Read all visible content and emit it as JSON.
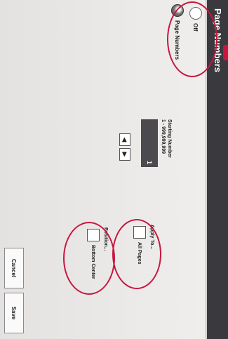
{
  "dialog": {
    "title": "Page Numbers"
  },
  "options": {
    "off_label": "Off",
    "page_numbers_label": "Page Numbers",
    "selected": "Page Numbers"
  },
  "starting_number": {
    "label_line1": "Starting Number",
    "label_line2": "1 - 999,999,999",
    "value": "1"
  },
  "stepper": {
    "prev": "◀",
    "next": "▶"
  },
  "apply_to": {
    "label": "Apply To...",
    "value": "All Pages"
  },
  "position": {
    "label": "Position...",
    "value": "Bottom Center"
  },
  "buttons": {
    "cancel": "Cancel",
    "save": "Save"
  },
  "annotation_color": "#c8163f"
}
